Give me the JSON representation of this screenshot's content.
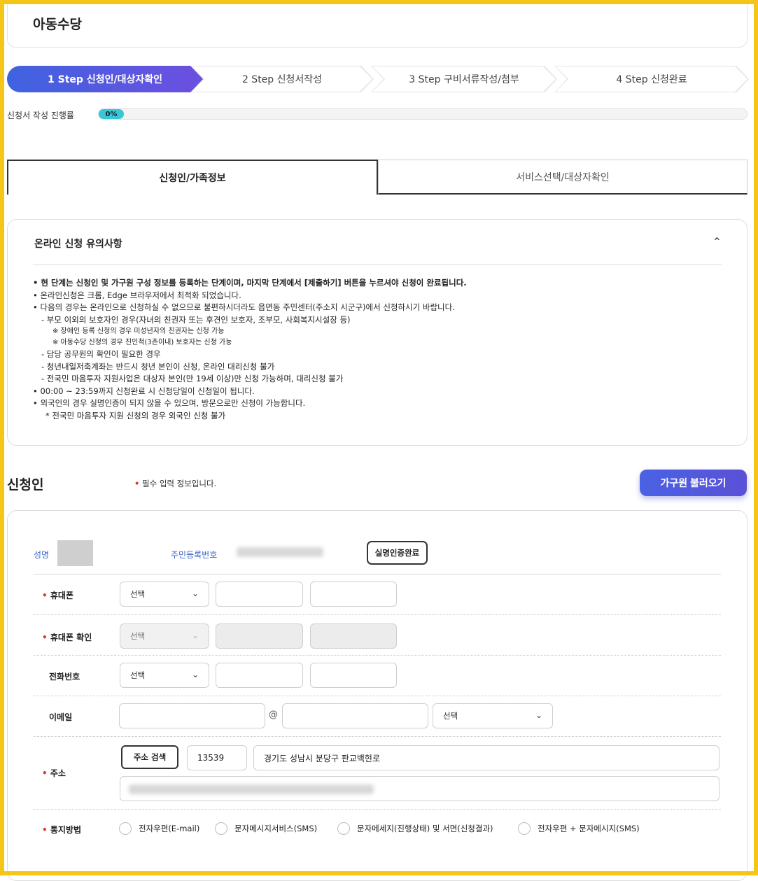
{
  "page": {
    "title": "아동수당"
  },
  "steps": [
    {
      "label": "1 Step 신청인/대상자확인",
      "active": true
    },
    {
      "label": "2 Step 신청서작성",
      "active": false
    },
    {
      "label": "3 Step 구비서류작성/첨부",
      "active": false
    },
    {
      "label": "4 Step 신청완료",
      "active": false
    }
  ],
  "progress": {
    "label": "신청서 작성 진행률",
    "value_text": "0%",
    "value": 0
  },
  "tabs": [
    {
      "label": "신청인/가족정보",
      "selected": true
    },
    {
      "label": "서비스선택/대상자확인",
      "selected": false
    }
  ],
  "notice": {
    "title": "온라인 신청 유의사항",
    "items": [
      {
        "text": "• 현 단계는 신청인 및 가구원 구성 정보를 등록하는 단계이며, 마지막 단계에서 [제출하기] 버튼을 누르셔야 신청이 완료됩니다.",
        "kind": "l1"
      },
      {
        "text": "• 온라인신청은 크롬, Edge 브라우저에서 최적화 되었습니다.",
        "kind": "l0"
      },
      {
        "text": "• 다음의 경우는 온라인으로 신청하실 수 없으므로 불편하시더라도 읍면동 주민센터(주소지 시군구)에서 신청하시기 바랍니다.",
        "kind": "l0"
      },
      {
        "text": "- 부모 이외의 보호자인 경우(자녀의 친권자 또는 후견인 보호자, 조부모, 사회복지시설장 등)",
        "kind": "sub"
      },
      {
        "text": "※ 장애인 등록 신청의 경우 미성년자의 친권자는 신청 가능",
        "kind": "sub2"
      },
      {
        "text": "※ 아동수당 신청의 경우 친인척(3촌이내) 보호자는 신청 가능",
        "kind": "sub2"
      },
      {
        "text": "- 담당 공무원의 확인이 필요한 경우",
        "kind": "sub"
      },
      {
        "text": "- 청년내일저축계좌는 반드시 청년 본인이 신청, 온라인 대리신청 불가",
        "kind": "sub"
      },
      {
        "text": "- 전국민 마음투자 지원사업은 대상자 본인(만 19세 이상)만 신청 가능하며, 대리신청 불가",
        "kind": "sub"
      },
      {
        "text": "• 00:00 ~ 23:59까지 신청완료 시 신청당일이 신청일이 됩니다.",
        "kind": "l0"
      },
      {
        "text": "• 외국인의 경우 실명인증이 되지 않을 수 있으며, 방문으로만 신청이 가능합니다.",
        "kind": "l0"
      },
      {
        "text": "* 전국민 마음투자 지원 신청의 경우 외국인 신청 불가",
        "kind": "star"
      }
    ]
  },
  "applicant": {
    "title": "신청인",
    "required_note": "필수 입력 정보입니다.",
    "load_family_button": "가구원 불러오기",
    "name_label": "성명",
    "id_label": "주민등록번호",
    "verify_button": "실명인증완료",
    "fields": {
      "phone": {
        "label": "휴대폰",
        "select": "선택",
        "required": true
      },
      "phone_confirm": {
        "label": "휴대폰 확인",
        "select": "선택",
        "required": true
      },
      "tel": {
        "label": "전화번호",
        "select": "선택",
        "required": false
      },
      "email": {
        "label": "이메일",
        "at": "@",
        "domain_select": "선택",
        "required": false
      },
      "address": {
        "label": "주소",
        "search_button": "주소 검색",
        "postcode": "13539",
        "road_address": "경기도 성남시 분당구 판교백현로",
        "required": true
      },
      "notify": {
        "label": "통지방법",
        "options": [
          "전자우편(E-mail)",
          "문자메시지서비스(SMS)",
          "문자메세지(진행상태) 및 서면(신청결과)",
          "전자우편 + 문자메시지(SMS)"
        ],
        "required": true
      }
    }
  },
  "colors": {
    "accent": "#4a5ee0",
    "progress": "#39c6d6",
    "required": "#e0302f",
    "label_blue": "#3a64c8",
    "frame": "#f5c518"
  }
}
